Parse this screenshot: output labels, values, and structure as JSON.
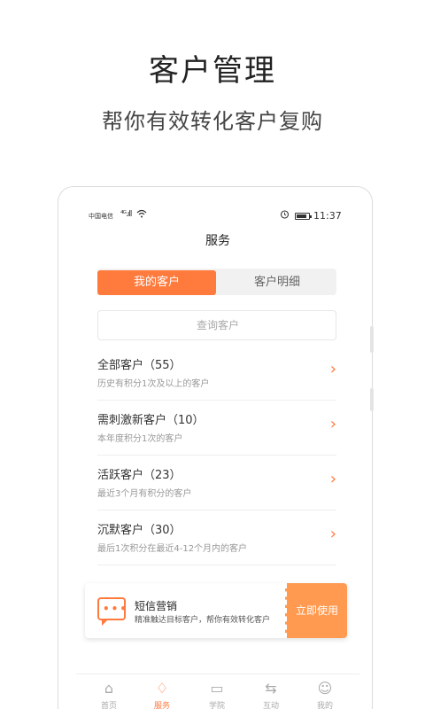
{
  "headline": "客户管理",
  "subline": "帮你有效转化客户复购",
  "status": {
    "carrier": "中国电信",
    "signal": "⁴ᴳ.ıll",
    "time": "11:37"
  },
  "page_title": "服务",
  "segments": {
    "active": "我的客户",
    "inactive": "客户明细"
  },
  "search": {
    "placeholder": "查询客户"
  },
  "list": [
    {
      "title": "全部客户（55）",
      "desc": "历史有积分1次及以上的客户",
      "arrow": "›"
    },
    {
      "title": "需刺激新客户（10）",
      "desc": "本年度积分1次的客户",
      "arrow": "›"
    },
    {
      "title": "活跃客户（23）",
      "desc": "最近3个月有积分的客户",
      "arrow": "›"
    },
    {
      "title": "沉默客户（30）",
      "desc": "最后1次积分在最近4-12个月内的客户",
      "arrow": "›"
    }
  ],
  "promo": {
    "title": "短信营销",
    "desc": "精准触达目标客户，帮你有效转化客户",
    "button": "立即使用",
    "icon": "message-icon"
  },
  "tabs": [
    {
      "label": "首页",
      "icon": "⌂"
    },
    {
      "label": "服务",
      "icon": "♢"
    },
    {
      "label": "学院",
      "icon": "▭"
    },
    {
      "label": "互动",
      "icon": "⇆"
    },
    {
      "label": "我的",
      "icon": "☺"
    }
  ],
  "colors": {
    "accent": "#ff7a3d"
  }
}
